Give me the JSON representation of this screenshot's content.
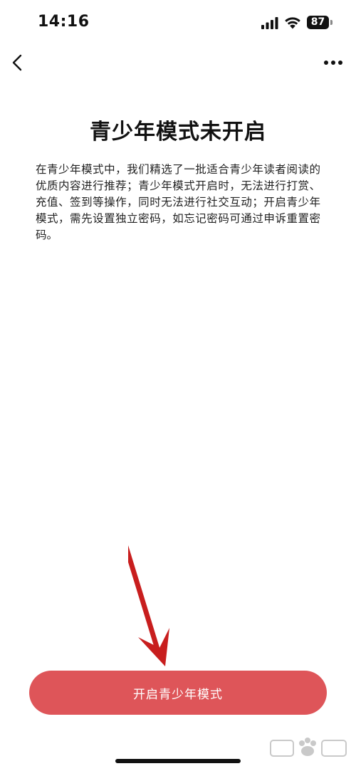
{
  "status_bar": {
    "time": "14:16",
    "battery_level": "87",
    "icons": [
      "signal-icon",
      "wifi-icon",
      "battery-icon"
    ]
  },
  "nav": {
    "back_icon": "chevron-left-icon",
    "more_icon": "more-horizontal-icon"
  },
  "main": {
    "title": "青少年模式未开启",
    "description": "在青少年模式中，我们精选了一批适合青少年读者阅读的优质内容进行推荐；青少年模式开启时，无法进行打赏、充值、签到等操作，同时无法进行社交互动；开启青少年模式，需先设置独立密码，如忘记密码可通过申诉重置密码。"
  },
  "action": {
    "button_label": "开启青少年模式",
    "button_color": "#de5559"
  },
  "overlay": {
    "annotation_icon": "red-arrow-icon",
    "arrow_color": "#c81e1e"
  }
}
